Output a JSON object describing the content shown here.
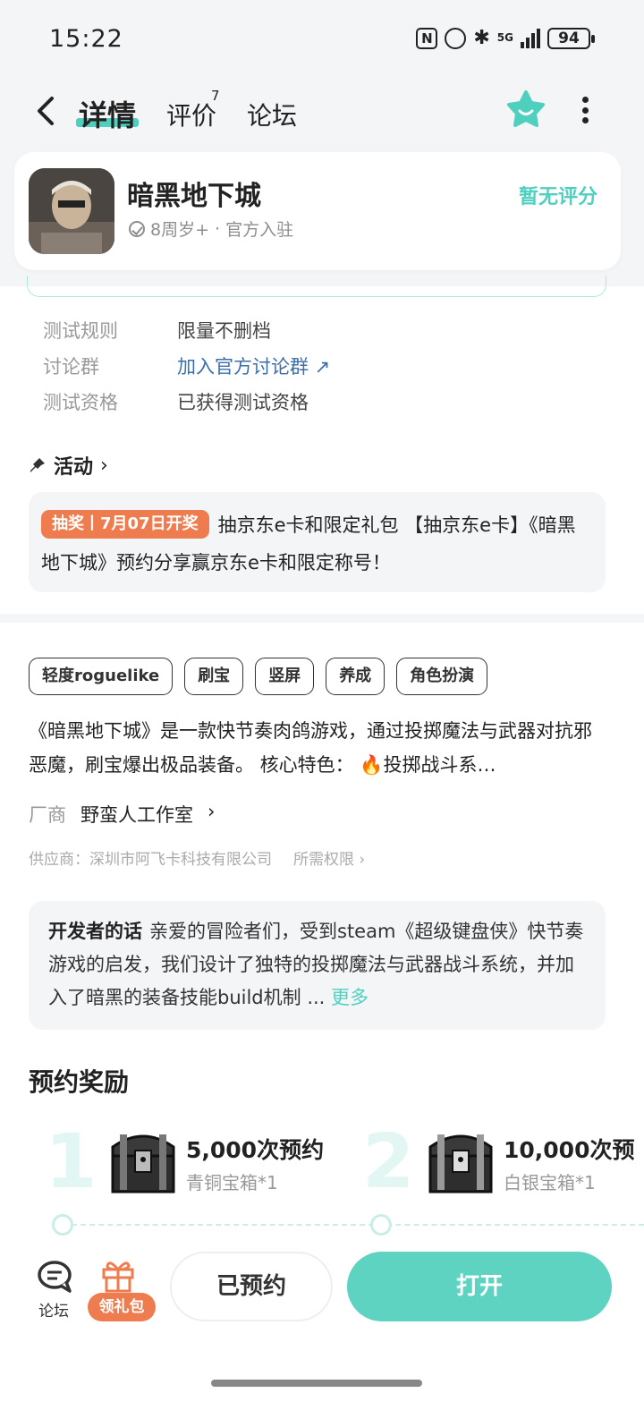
{
  "status_bar": {
    "time": "15:22",
    "network": "5G",
    "battery": "94"
  },
  "nav": {
    "tabs": [
      {
        "label": "详情"
      },
      {
        "label": "评价"
      },
      {
        "label": "论坛"
      }
    ],
    "review_badge": "7"
  },
  "app": {
    "name": "暗黑地下城",
    "age_rating": "8周岁+",
    "official": "官方入驻",
    "score": "暂无评分"
  },
  "info": [
    {
      "label": "测试规则",
      "value": "限量不删档"
    },
    {
      "label": "讨论群",
      "value": "加入官方讨论群"
    },
    {
      "label": "测试资格",
      "value": "已获得测试资格"
    }
  ],
  "activity": {
    "title": "活动",
    "badge": "抽奖丨7月07日开奖",
    "text": "抽京东e卡和限定礼包 【抽京东e卡】《暗黑地下城》预约分享赢京东e卡和限定称号！"
  },
  "tags": [
    "轻度roguelike",
    "刷宝",
    "竖屏",
    "养成",
    "角色扮演"
  ],
  "description": "《暗黑地下城》是一款快节奏肉鸽游戏，通过投掷魔法与武器对抗邪恶魔，刷宝爆出极品装备。 核心特色： 🔥投掷战斗系…",
  "maker": {
    "label": "厂商",
    "value": "野蛮人工作室"
  },
  "supplier": {
    "text": "供应商：深圳市阿飞卡科技有限公司",
    "permissions": "所需权限"
  },
  "developer_note": {
    "title": "开发者的话",
    "text": "亲爱的冒险者们，受到steam《超级键盘侠》快节奏游戏的启发，我们设计了独特的投掷魔法与武器战斗系统，并加入了暗黑的装备技能build机制 ...",
    "more": "更多"
  },
  "rewards": {
    "title": "预约奖励",
    "items": [
      {
        "rank": "1",
        "milestone": "5,000次预约",
        "reward": "青铜宝箱*1"
      },
      {
        "rank": "2",
        "milestone": "10,000次预",
        "reward": "白银宝箱*1"
      }
    ]
  },
  "bottom": {
    "forum": "论坛",
    "gift": "领礼包",
    "reserved": "已预约",
    "open": "打开"
  },
  "colors": {
    "accent": "#5fd3c2",
    "orange": "#ee7c4f",
    "link": "#3b6fa5"
  }
}
